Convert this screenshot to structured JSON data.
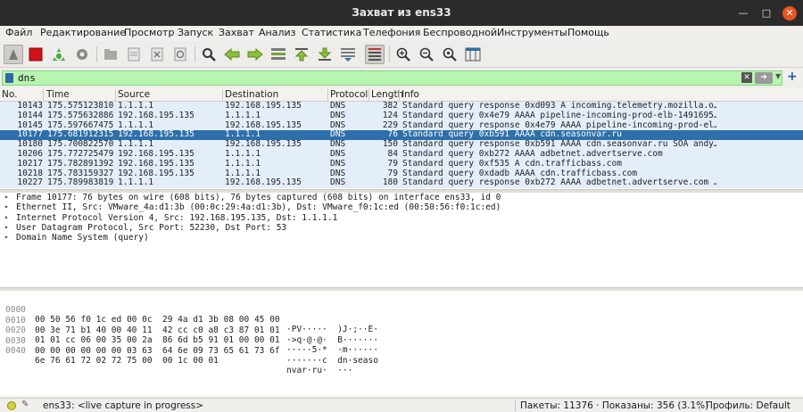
{
  "window": {
    "title": "Захват из ens33"
  },
  "menu": [
    "Файл",
    "Редактирование",
    "Просмотр",
    "Запуск",
    "Захват",
    "Анализ",
    "Статистика",
    "Телефония",
    "Беспроводной",
    "Инструменты",
    "Помощь"
  ],
  "toolbar_icons": [
    "shark-fin-start-icon",
    "stop-icon",
    "restart-icon",
    "options-gear-icon",
    "open-folder-icon",
    "save-icon",
    "close-file-icon",
    "reload-icon",
    "find-icon",
    "back-icon",
    "forward-icon",
    "goto-packet-icon",
    "first-packet-icon",
    "last-packet-icon",
    "autoscroll-icon",
    "colorize-icon",
    "zoom-in-icon",
    "zoom-out-icon",
    "zoom-reset-icon",
    "resize-columns-icon"
  ],
  "filter": {
    "value": "dns",
    "clear_icon": "clear-icon",
    "apply_icon": "arrow-right-icon",
    "add_label": "+"
  },
  "columns": [
    "No.",
    "Time",
    "Source",
    "Destination",
    "Protocol",
    "Length",
    "Info"
  ],
  "packets": [
    {
      "no": "10143",
      "time": "175.575123810",
      "src": "1.1.1.1",
      "dst": "192.168.195.135",
      "proto": "DNS",
      "len": "382",
      "info": "Standard query response 0xd093 A incoming.telemetry.mozilla.o…"
    },
    {
      "no": "10144",
      "time": "175.575632886",
      "src": "192.168.195.135",
      "dst": "1.1.1.1",
      "proto": "DNS",
      "len": "124",
      "info": "Standard query 0x4e79 AAAA pipeline-incoming-prod-elb-1491695…"
    },
    {
      "no": "10145",
      "time": "175.597667475",
      "src": "1.1.1.1",
      "dst": "192.168.195.135",
      "proto": "DNS",
      "len": "229",
      "info": "Standard query response 0x4e79 AAAA pipeline-incoming-prod-el…"
    },
    {
      "no": "10177",
      "time": "175.681912315",
      "src": "192.168.195.135",
      "dst": "1.1.1.1",
      "proto": "DNS",
      "len": "76",
      "info": "Standard query 0xb591 AAAA cdn.seasonvar.ru",
      "selected": true
    },
    {
      "no": "10180",
      "time": "175.700822570",
      "src": "1.1.1.1",
      "dst": "192.168.195.135",
      "proto": "DNS",
      "len": "150",
      "info": "Standard query response 0xb591 AAAA cdn.seasonvar.ru SOA andy…"
    },
    {
      "no": "10206",
      "time": "175.772725479",
      "src": "192.168.195.135",
      "dst": "1.1.1.1",
      "proto": "DNS",
      "len": "84",
      "info": "Standard query 0xb272 AAAA adbetnet.advertserve.com"
    },
    {
      "no": "10217",
      "time": "175.782891392",
      "src": "192.168.195.135",
      "dst": "1.1.1.1",
      "proto": "DNS",
      "len": "79",
      "info": "Standard query 0xf535 A cdn.trafficbass.com"
    },
    {
      "no": "10218",
      "time": "175.783159327",
      "src": "192.168.195.135",
      "dst": "1.1.1.1",
      "proto": "DNS",
      "len": "79",
      "info": "Standard query 0xdadb AAAA cdn.trafficbass.com"
    },
    {
      "no": "10227",
      "time": "175.789983819",
      "src": "1.1.1.1",
      "dst": "192.168.195.135",
      "proto": "DNS",
      "len": "180",
      "info": "Standard query response 0xb272 AAAA adbetnet.advertserve.com …"
    }
  ],
  "details": [
    "Frame 10177: 76 bytes on wire (608 bits), 76 bytes captured (608 bits) on interface ens33, id 0",
    "Ethernet II, Src: VMware_4a:d1:3b (00:0c:29:4a:d1:3b), Dst: VMware_f0:1c:ed (00:50:56:f0:1c:ed)",
    "Internet Protocol Version 4, Src: 192.168.195.135, Dst: 1.1.1.1",
    "User Datagram Protocol, Src Port: 52230, Dst Port: 53",
    "Domain Name System (query)"
  ],
  "bytes": [
    {
      "off": "0000",
      "hex": "00 50 56 f0 1c ed 00 0c  29 4a d1 3b 08 00 45 00",
      "ascii": "·PV·····  )J·;··E·"
    },
    {
      "off": "0010",
      "hex": "00 3e 71 b1 40 00 40 11  42 cc c0 a8 c3 87 01 01",
      "ascii": "·>q·@·@·  B·······"
    },
    {
      "off": "0020",
      "hex": "01 01 cc 06 00 35 00 2a  86 6d b5 91 01 00 00 01",
      "ascii": "·····5·*  ·m······"
    },
    {
      "off": "0030",
      "hex": "00 00 00 00 00 00 03 63  64 6e 09 73 65 61 73 6f",
      "ascii": "·······c  dn·seaso"
    },
    {
      "off": "0040",
      "hex": "6e 76 61 72 02 72 75 00  00 1c 00 01",
      "ascii": "nvar·ru·  ···"
    }
  ],
  "status": {
    "capture": "ens33: <live capture in progress>",
    "packets": "Пакеты: 11376 · Показаны: 356 (3.1%)",
    "profile": "Профиль: Default"
  },
  "colors": {
    "selected_row": "#2d6fab",
    "dns_row": "#e3eefa",
    "filter_valid": "#b8f5b1",
    "titlebar": "#2b2b2b"
  }
}
